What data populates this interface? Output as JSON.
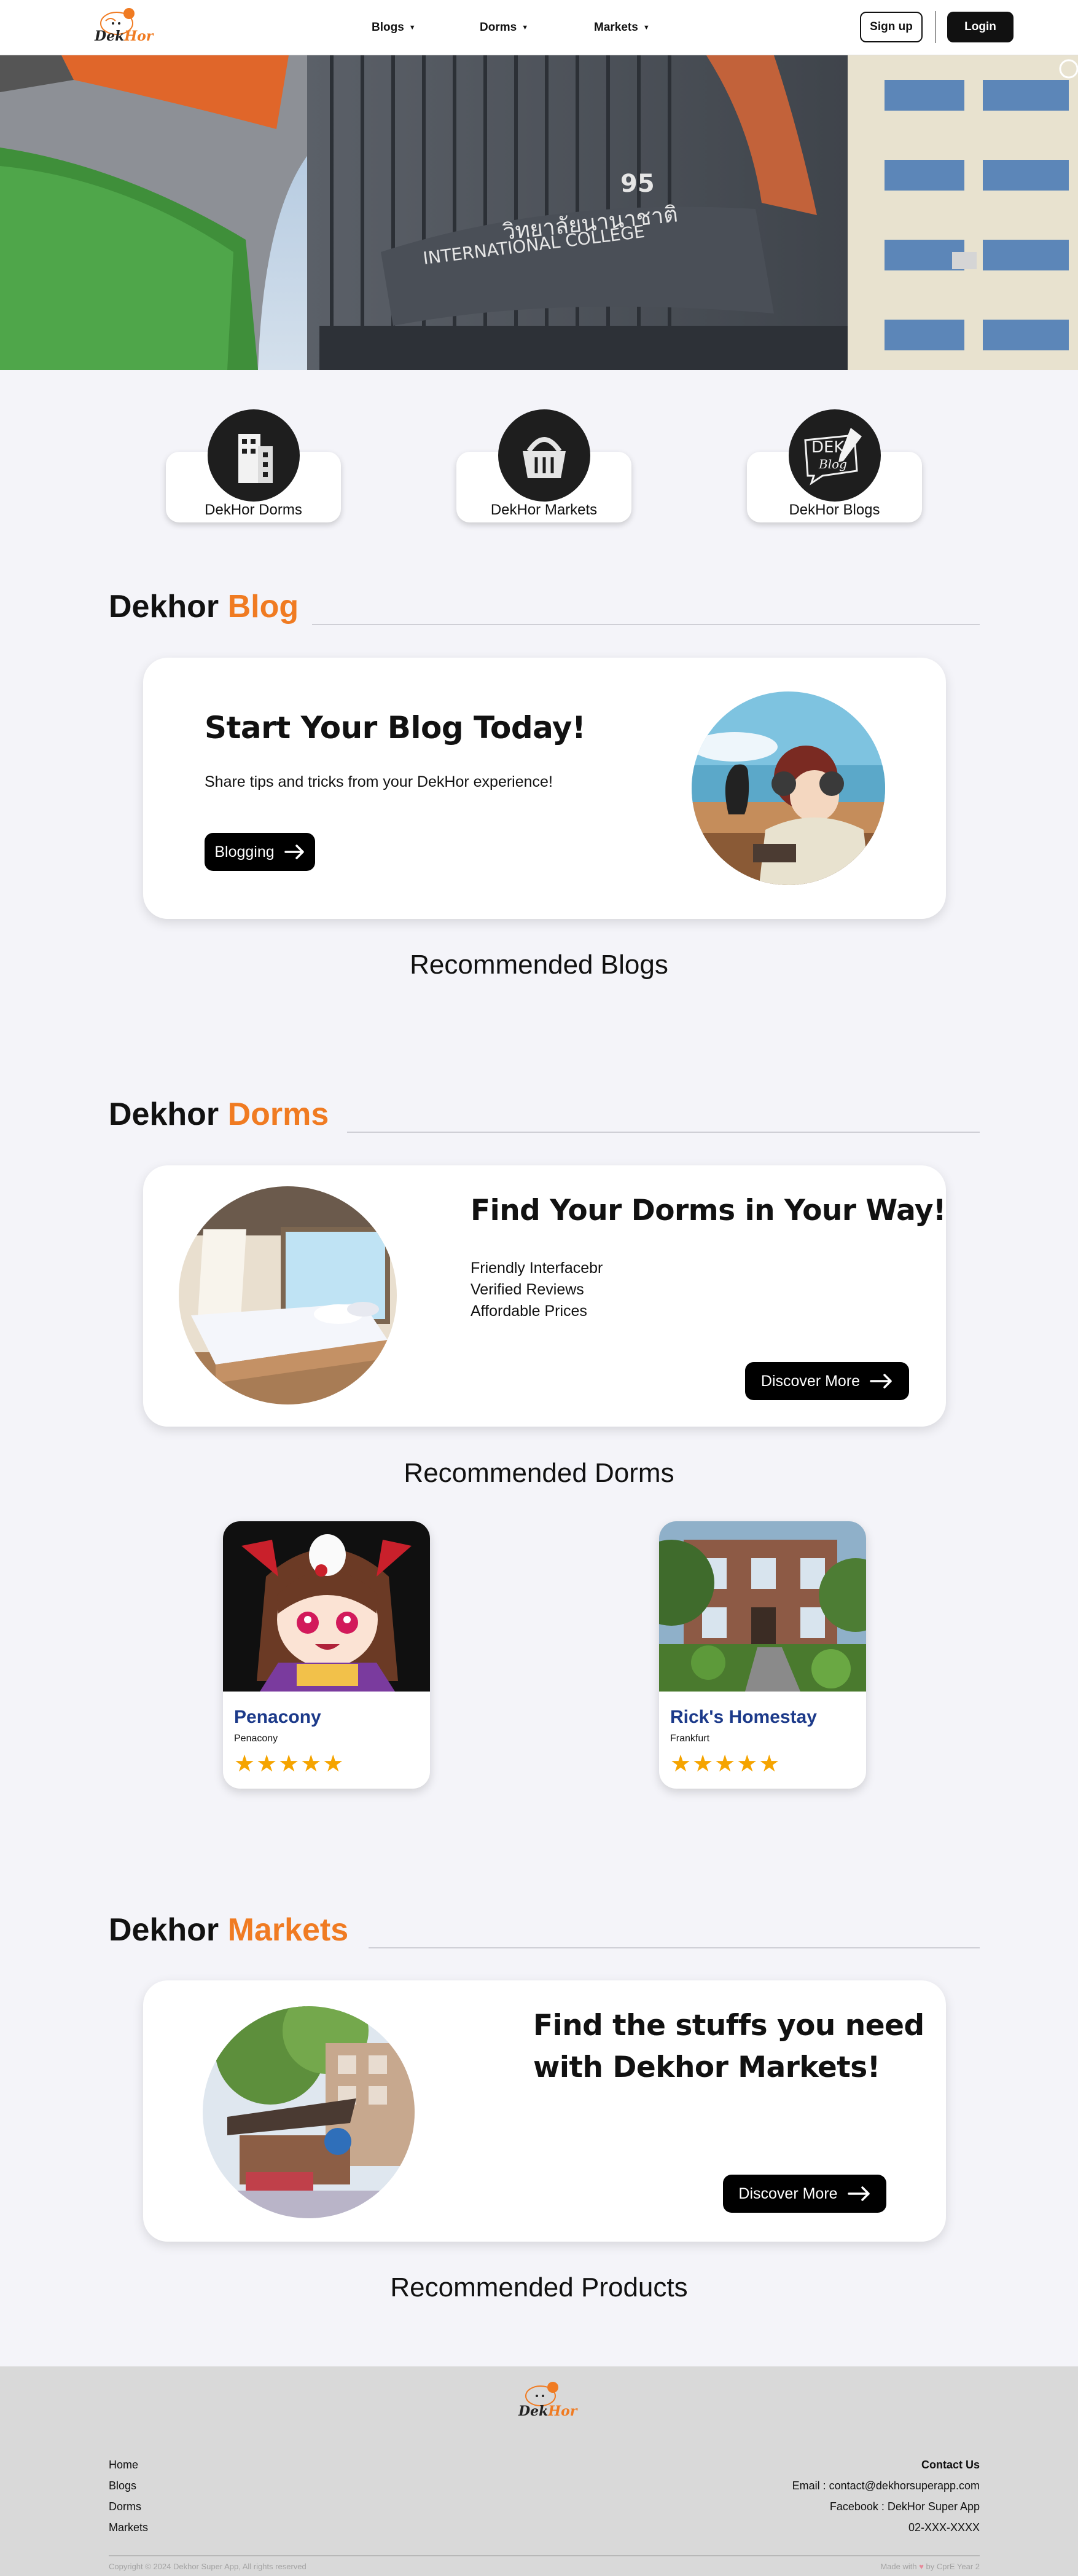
{
  "navbar": {
    "logo_text_1": "Dek",
    "logo_text_2": "Hor",
    "menus": [
      {
        "label": "Blogs"
      },
      {
        "label": "Dorms"
      },
      {
        "label": "Markets"
      }
    ],
    "signup_label": "Sign up",
    "login_label": "Login"
  },
  "hero": {
    "building_number": "95",
    "building_thai": "วิทยาลัยนานาชาติ",
    "building_english": "INTERNATIONAL COLLEGE"
  },
  "categories": [
    {
      "label": "DekHor Dorms"
    },
    {
      "label": "DekHor Markets"
    },
    {
      "label": "DekHor Blogs",
      "icon_text_1": "DEK",
      "icon_text_2": "Blog"
    }
  ],
  "blog_section": {
    "title_prefix": "Dekhor",
    "title_accent": "Blog",
    "heading": "Start Your Blog Today!",
    "text": "Share tips and tricks from your DekHor experience!",
    "button_label": "Blogging",
    "recommended_title": "Recommended Blogs"
  },
  "dorms_section": {
    "title_prefix": "Dekhor",
    "title_accent": "Dorms",
    "heading": "Find Your Dorms in Your Way!",
    "features": [
      "Friendly Interfacebr",
      "Verified Reviews",
      "Affordable Prices"
    ],
    "button_label": "Discover More",
    "recommended_title": "Recommended Dorms",
    "dorms": [
      {
        "name": "Penacony",
        "location": "Penacony",
        "rating": 5
      },
      {
        "name": "Rick's Homestay",
        "location": "Frankfurt",
        "rating": 5
      }
    ]
  },
  "markets_section": {
    "title_prefix": "Dekhor",
    "title_accent": "Markets",
    "heading_line_1": "Find the stuffs you need",
    "heading_line_2": "with Dekhor Markets!",
    "button_label": "Discover More",
    "recommended_title": "Recommended Products"
  },
  "footer": {
    "links": [
      "Home",
      "Blogs",
      "Dorms",
      "Markets"
    ],
    "contact_title": "Contact Us",
    "email": "Email : contact@dekhorsuperapp.com",
    "facebook": "Facebook : DekHor Super App",
    "phone": "02-XXX-XXXX",
    "copyright": "Copyright © 2024 Dekhor Super App, All rights reserved",
    "made_with_prefix": "Made with",
    "made_with_suffix": "by CprE Year 2"
  },
  "colors": {
    "accent": "#f07b22",
    "dorm_name": "#1c3a8a",
    "star": "#f5a400",
    "footer_bg": "#d9d9d9"
  }
}
